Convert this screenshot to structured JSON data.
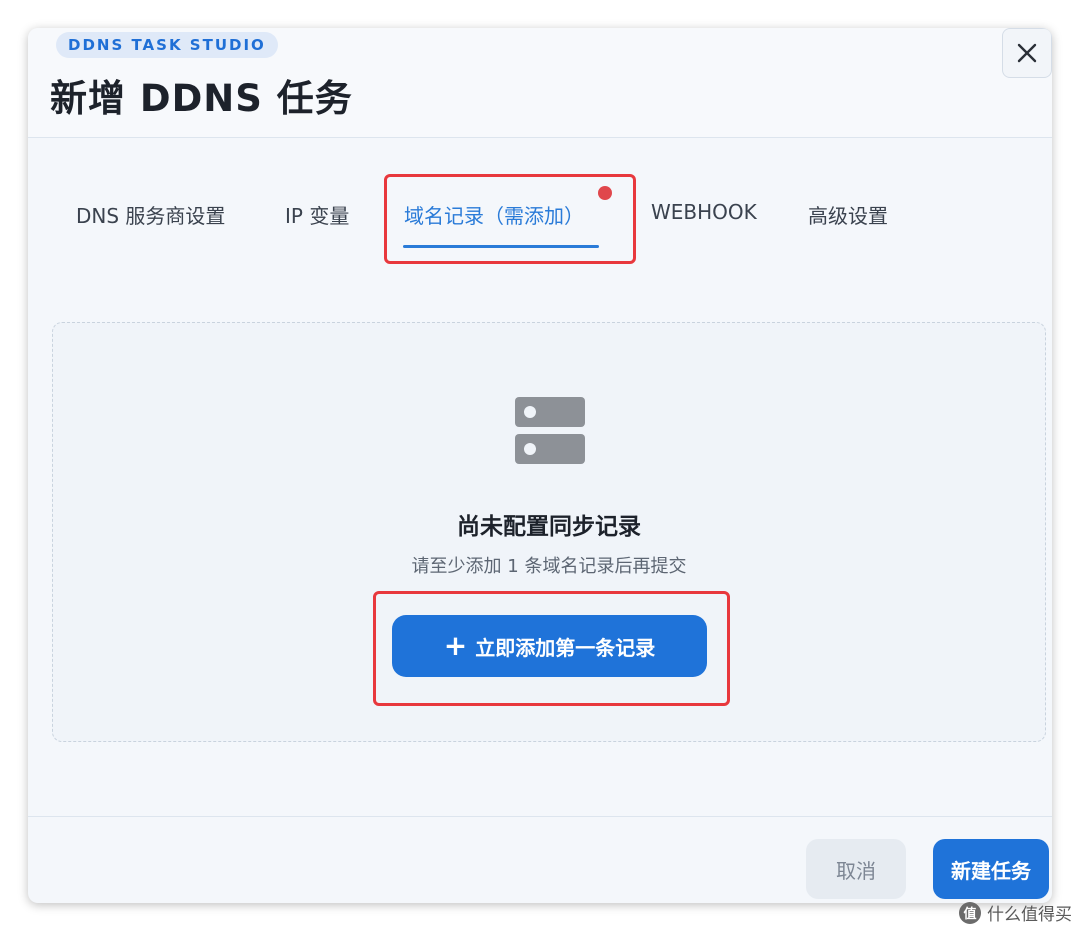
{
  "header": {
    "badge": "DDNS TASK STUDIO",
    "title": "新增 DDNS 任务",
    "close_icon": "close-icon"
  },
  "tabs": [
    {
      "label": "DNS 服务商设置",
      "active": false
    },
    {
      "label": "IP 变量",
      "active": false
    },
    {
      "label": "域名记录（需添加）",
      "active": true
    },
    {
      "label": "WEBHOOK",
      "active": false
    },
    {
      "label": "高级设置",
      "active": false
    }
  ],
  "empty_state": {
    "icon": "server-icon",
    "title": "尚未配置同步记录",
    "subtitle": "请至少添加 1 条域名记录后再提交",
    "add_button": "立即添加第一条记录",
    "add_button_icon": "+"
  },
  "footer": {
    "cancel": "取消",
    "create": "新建任务"
  },
  "watermark": {
    "icon_text": "值",
    "text": "什么值得买"
  },
  "colors": {
    "accent": "#1f73d9",
    "highlight": "#e8383d",
    "dot": "#e0474c"
  }
}
